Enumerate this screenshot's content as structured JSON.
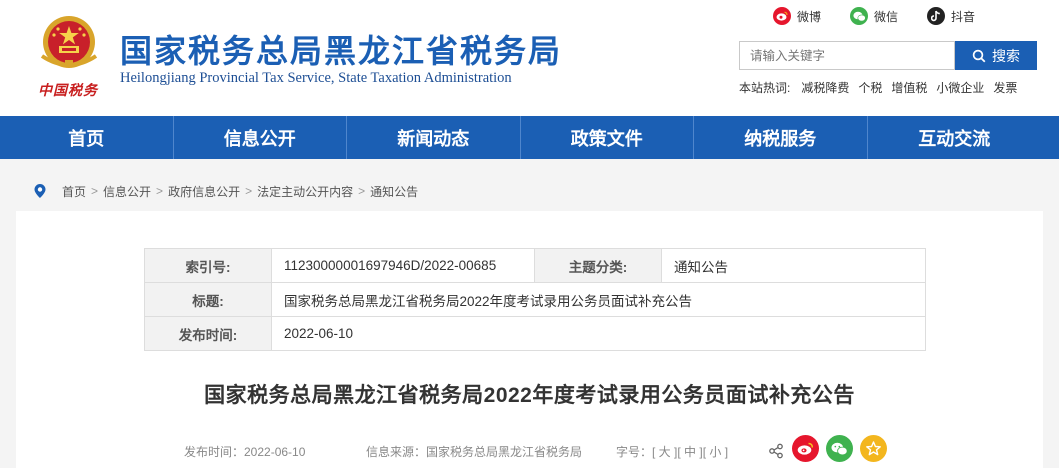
{
  "header": {
    "title": "国家税务总局黑龙江省税务局",
    "subtitle": "Heilongjiang Provincial Tax Service, State Taxation Administration",
    "logo_text": "中国税务",
    "social": {
      "weibo": "微博",
      "weixin": "微信",
      "douyin": "抖音"
    },
    "search": {
      "placeholder": "请输入关键字",
      "button": "搜索"
    },
    "hotwords": {
      "label": "本站热词:",
      "items": [
        "减税降费",
        "个税",
        "增值税",
        "小微企业",
        "发票"
      ]
    }
  },
  "nav": {
    "items": [
      "首页",
      "信息公开",
      "新闻动态",
      "政策文件",
      "纳税服务",
      "互动交流"
    ]
  },
  "breadcrumb": [
    "首页",
    "信息公开",
    "政府信息公开",
    "法定主动公开内容",
    "通知公告"
  ],
  "breadcrumb_sep": ">",
  "meta": {
    "index_label": "索引号:",
    "index_value": "11230000001697946D/2022-00685",
    "category_label": "主题分类:",
    "category_value": "通知公告",
    "title_label": "标题:",
    "title_value": "国家税务总局黑龙江省税务局2022年度考试录用公务员面试补充公告",
    "date_label": "发布时间:",
    "date_value": "2022-06-10"
  },
  "article": {
    "title": "国家税务总局黑龙江省税务局2022年度考试录用公务员面试补充公告",
    "publish": "发布时间：2022-06-10",
    "source": "信息来源：国家税务总局黑龙江省税务局",
    "font_size_label": "字号：",
    "font_size_large": "[ 大 ]",
    "font_size_mid": "[ 中 ]",
    "font_size_small": "[ 小 ]"
  },
  "colors": {
    "brand_blue": "#1b5fb4",
    "weibo_red": "#e6162d",
    "weixin_green": "#3fb24f",
    "fav_yellow": "#f3b61e"
  }
}
